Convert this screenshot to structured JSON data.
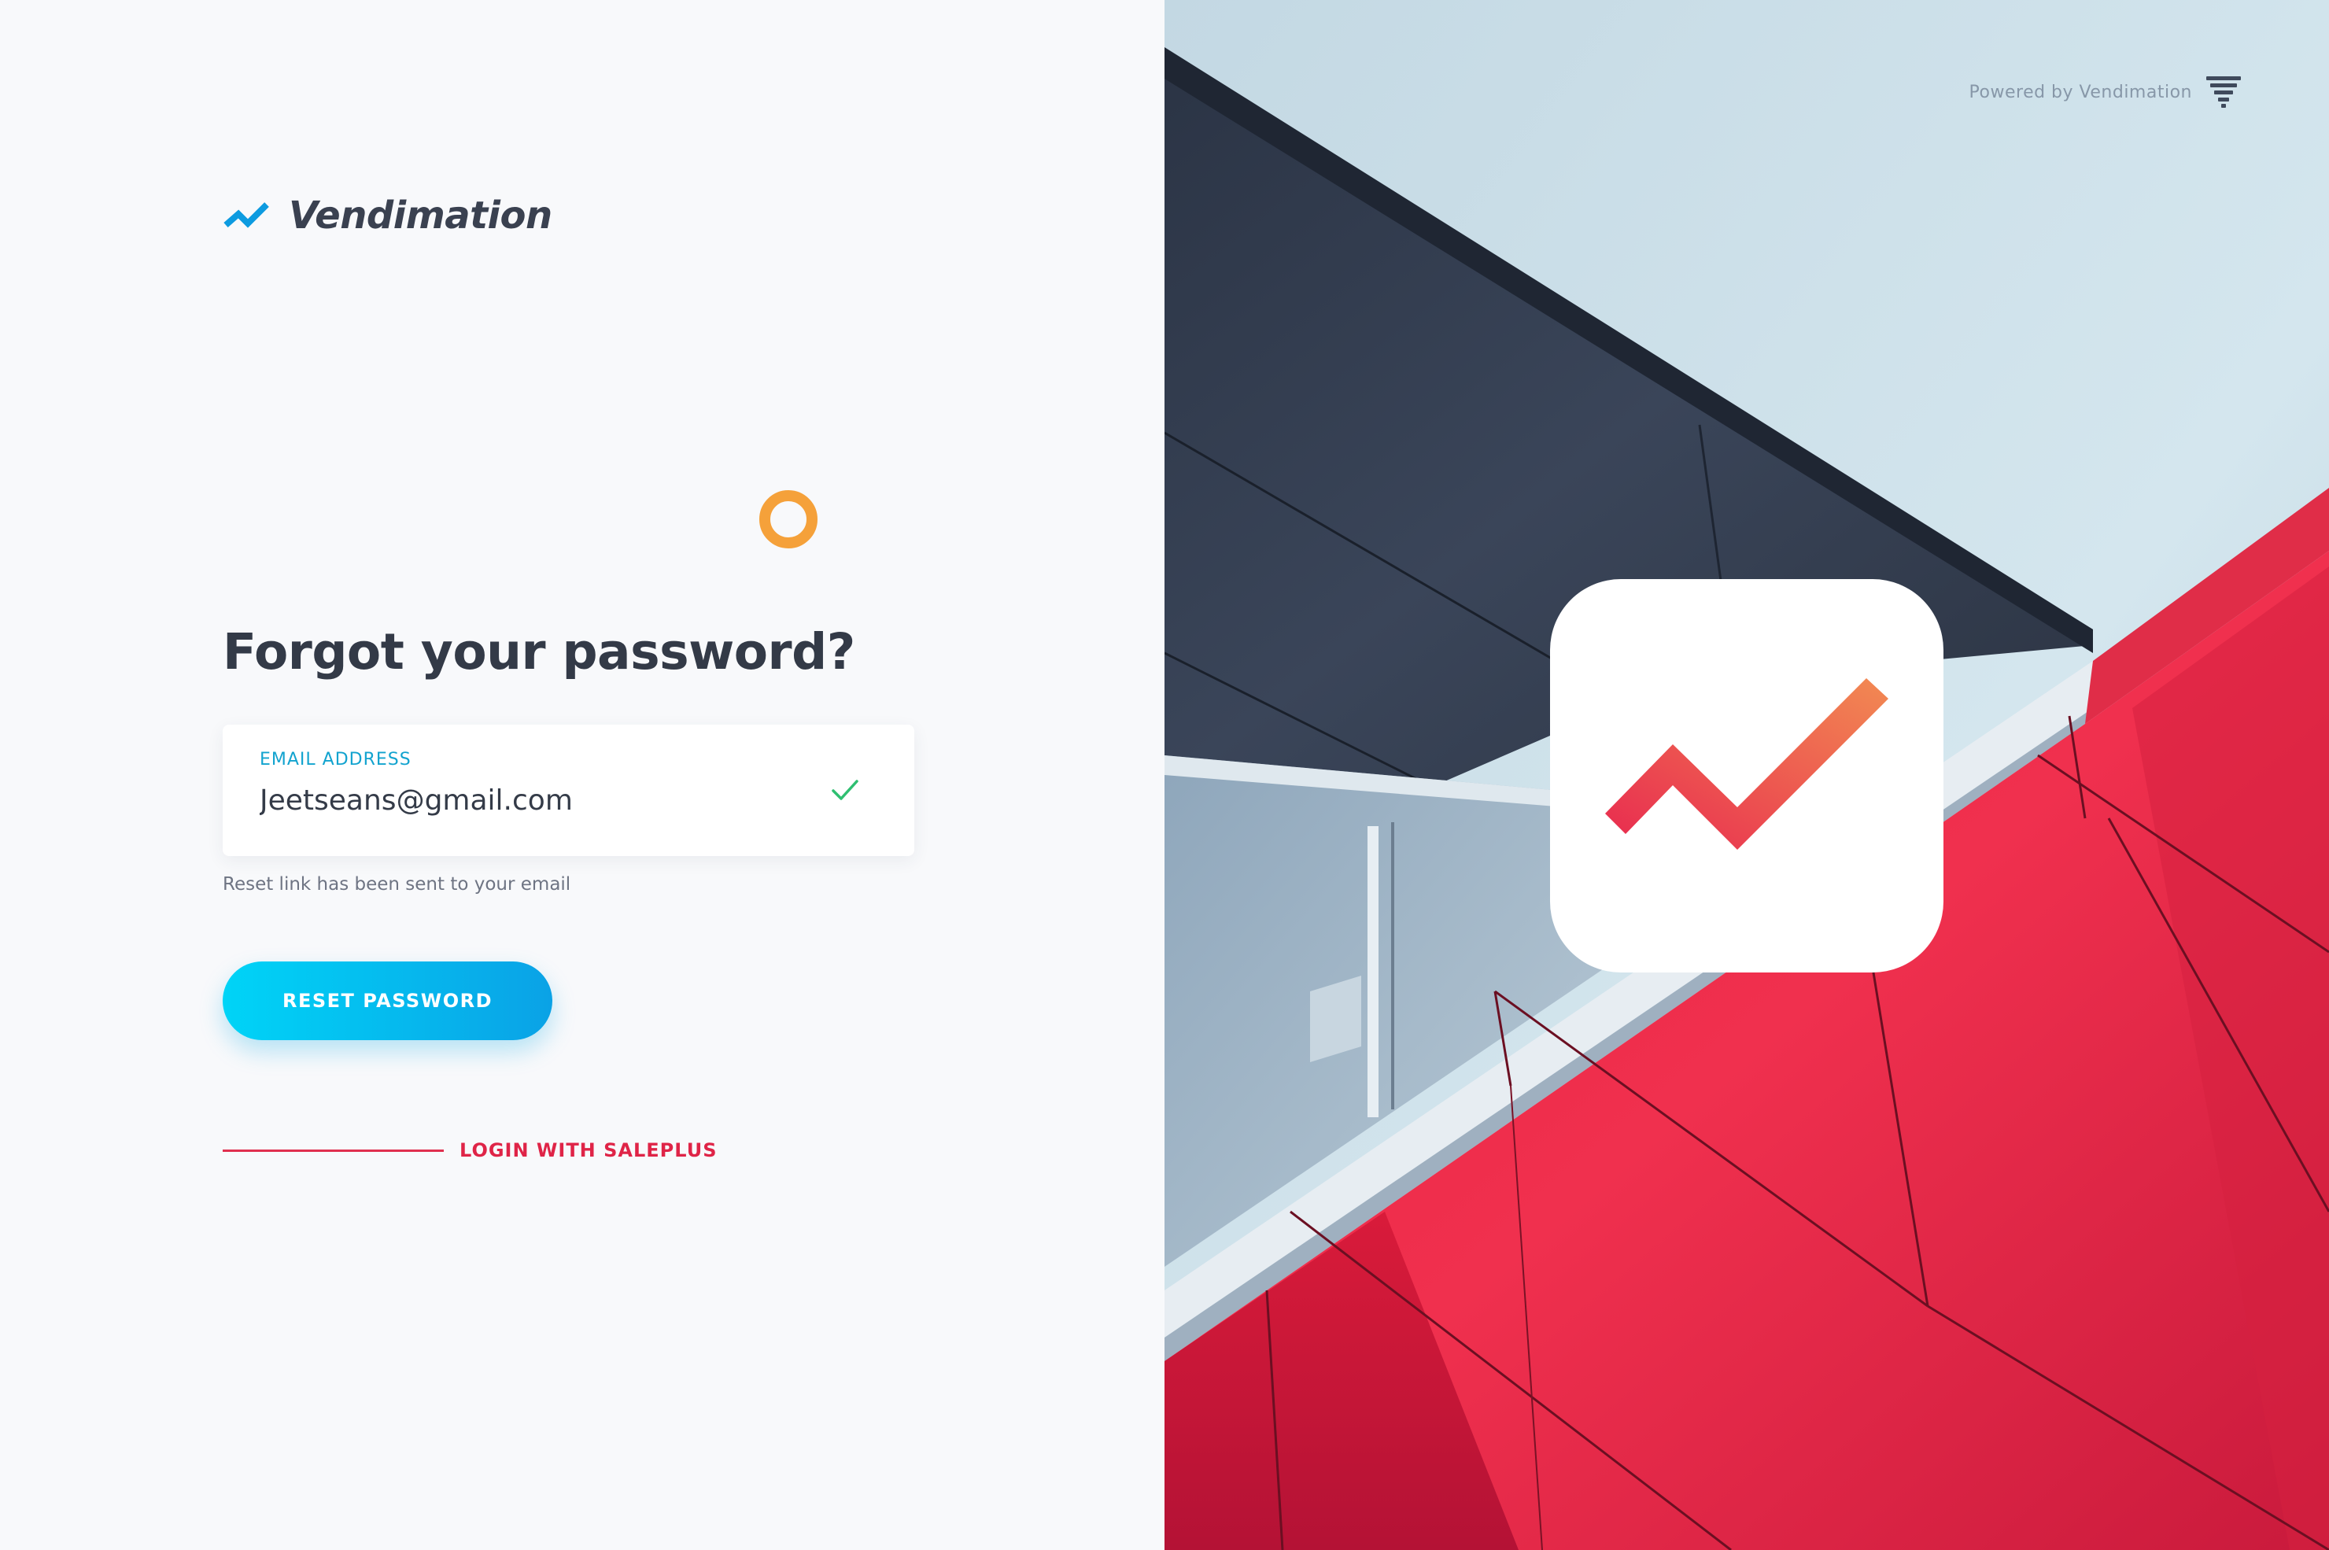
{
  "brand": {
    "name": "Vendimation",
    "logo_icon": "trend-up-icon",
    "logo_color": "#0d9be0"
  },
  "form": {
    "title": "Forgot your password?",
    "email_label": "EMAIL ADDRESS",
    "email_value": "Jeetseans@gmail.com",
    "valid_icon": "check-icon",
    "hint": "Reset link has been sent to your email",
    "reset_label": "RESET PASSWORD",
    "alt_login_label": "LOGIN WITH SALEPLUS"
  },
  "powered_by": {
    "text": "Powered by Vendimation",
    "icon": "funnel-logo-icon"
  },
  "colors": {
    "accent_cyan": "#00c8f2",
    "accent_red": "#df2447",
    "accent_orange": "#f5a13a",
    "success_green": "#2fbf71"
  }
}
